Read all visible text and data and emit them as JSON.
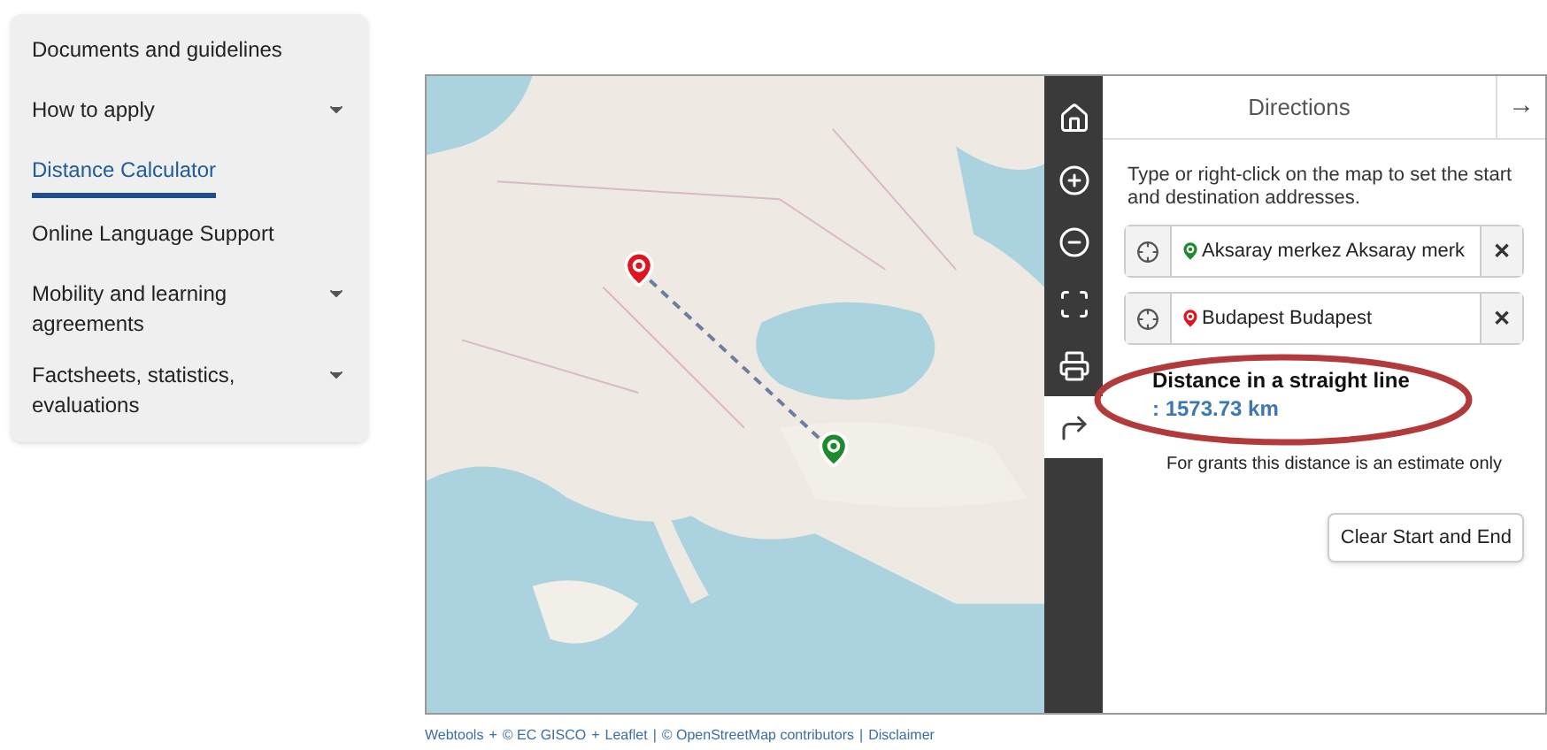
{
  "sidebar": {
    "items": [
      {
        "label": "Documents and guidelines",
        "selected": false,
        "expandable": false
      },
      {
        "label": "How to apply",
        "selected": false,
        "expandable": true
      },
      {
        "label": "Distance Calculator",
        "selected": true,
        "expandable": false
      },
      {
        "label": "Online Language Support",
        "selected": false,
        "expandable": false
      },
      {
        "label": "Mobility and learning agreements",
        "selected": false,
        "expandable": true
      },
      {
        "label": "Factsheets, statistics, evaluations",
        "selected": false,
        "expandable": true
      }
    ]
  },
  "map": {
    "kind": "picture",
    "toolbar": [
      {
        "kind": "home",
        "selected": false
      },
      {
        "kind": "zoom-in",
        "selected": false
      },
      {
        "kind": "zoom-out",
        "selected": false
      },
      {
        "kind": "fullscreen",
        "selected": false
      },
      {
        "kind": "print",
        "selected": false
      },
      {
        "kind": "directions",
        "selected": true
      }
    ]
  },
  "directions": {
    "title": "Directions",
    "close": "→",
    "hint": "Type or right-click on the map to set the start and destination addresses.",
    "stops": [
      {
        "value": "Aksaray merkez  Aksaray merk",
        "color": "#1e8a2e"
      },
      {
        "value": "Budapest  Budapest",
        "color": "#e0141e"
      }
    ],
    "remove": "✕",
    "result_label": "Distance in a straight line",
    "result_value": ": 1573.73 km",
    "note": "For grants this distance is an estimate only",
    "clear_button": "Clear Start and End"
  },
  "attribution": [
    "Webtools",
    "+",
    "© EC GISCO",
    "+",
    "Leaflet",
    "|",
    "© OpenStreetMap contributors",
    "|",
    "Disclaimer"
  ]
}
